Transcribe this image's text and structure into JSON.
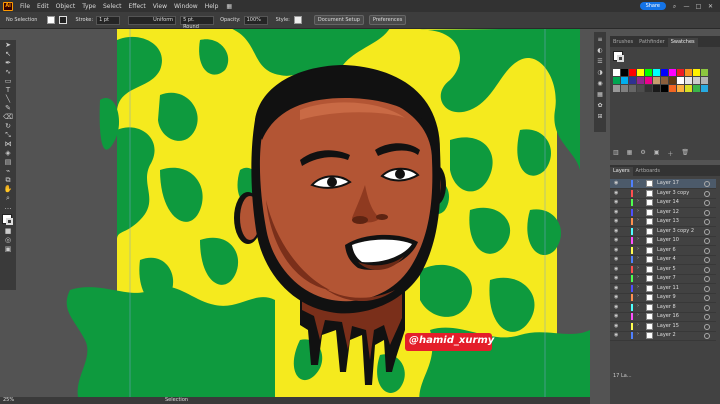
{
  "menubar": {
    "logo": "Ai",
    "items": [
      "File",
      "Edit",
      "Object",
      "Type",
      "Select",
      "Effect",
      "View",
      "Window",
      "Help"
    ],
    "share_label": "Share"
  },
  "controlbar": {
    "selection_label": "No Selection",
    "stroke_label": "Stroke:",
    "stroke_value": "1 pt",
    "profile_value": "Uniform",
    "brush_value": "5 pt. Round",
    "opacity_label": "Opacity:",
    "opacity_value": "100%",
    "style_label": "Style:",
    "doc_setup_label": "Document Setup",
    "preferences_label": "Preferences"
  },
  "colors": {
    "background_green": "#0e9a3e",
    "blob_yellow": "#f7ec2a",
    "skin": "#b35534",
    "skin_shadow": "#7a2f1a",
    "hair": "#111111",
    "accent_blue": "#1473e6"
  },
  "artwork": {
    "watermark": "@hamid_xurmy"
  },
  "swatches_panel": {
    "tabs": [
      "Brushes",
      "Pathfinder",
      "Swatches"
    ],
    "active_tab": "Swatches",
    "colors": [
      "#ffffff",
      "#000000",
      "#ff0000",
      "#ffff00",
      "#00ff00",
      "#00ffff",
      "#0000ff",
      "#ff00ff",
      "#ed1c24",
      "#f7941d",
      "#fff200",
      "#8dc63f",
      "#00a651",
      "#00aeef",
      "#2e3192",
      "#92278f",
      "#ec008c",
      "#c69c6d",
      "#8b5e3c",
      "#603913",
      "#ffffff",
      "#e6e6e6",
      "#cccccc",
      "#b3b3b3",
      "#999999",
      "#808080",
      "#666666",
      "#4d4d4d",
      "#333333",
      "#1a1a1a",
      "#000000",
      "#f26522",
      "#fbb040",
      "#d7df23",
      "#39b54a",
      "#27aae1"
    ]
  },
  "layers_panel": {
    "tabs": [
      "Layers",
      "Artboards"
    ],
    "layers": [
      {
        "name": "Layer 17",
        "color": "#4f80ff",
        "active": true
      },
      {
        "name": "Layer 3 copy",
        "color": "#ff4f4f"
      },
      {
        "name": "Layer 14",
        "color": "#4fff4f"
      },
      {
        "name": "Layer 12",
        "color": "#4f4fff"
      },
      {
        "name": "Layer 13",
        "color": "#ff8f4f"
      },
      {
        "name": "Layer 3 copy 2",
        "color": "#4fffff"
      },
      {
        "name": "Layer 10",
        "color": "#ff4fff"
      },
      {
        "name": "Layer 6",
        "color": "#ffff4f"
      },
      {
        "name": "Layer 4",
        "color": "#4f80ff"
      },
      {
        "name": "Layer 5",
        "color": "#ff4f4f"
      },
      {
        "name": "Layer 7",
        "color": "#4fff4f"
      },
      {
        "name": "Layer 11",
        "color": "#4f4fff"
      },
      {
        "name": "Layer 9",
        "color": "#ff8f4f"
      },
      {
        "name": "Layer 8",
        "color": "#4fffff"
      },
      {
        "name": "Layer 16",
        "color": "#ff4fff"
      },
      {
        "name": "Layer 15",
        "color": "#ffff4f"
      },
      {
        "name": "Layer 2",
        "color": "#4f80ff"
      }
    ],
    "count_label": "17 La..."
  },
  "statusbar": {
    "zoom": "25%",
    "selection_tool": "Selection"
  }
}
